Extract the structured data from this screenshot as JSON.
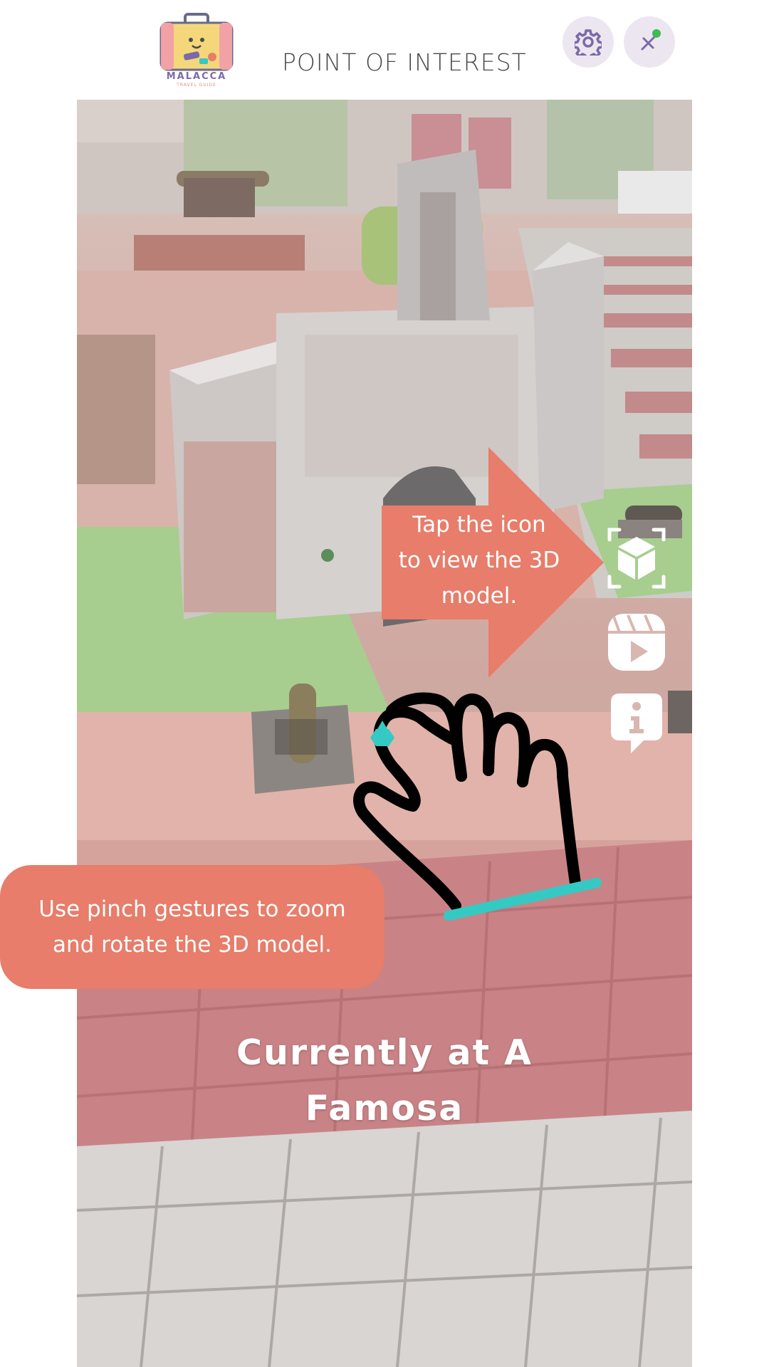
{
  "header": {
    "logo_text": "MALACCA",
    "logo_subtext": "TRAVEL GUIDE",
    "title": "POINT OF INTEREST",
    "settings_icon": "gear-icon",
    "ar_icon": "ar-toggle-icon"
  },
  "side_actions": [
    {
      "icon": "3d-cube-icon",
      "label": "View 3D model"
    },
    {
      "icon": "reels-play-icon",
      "label": "Play video"
    },
    {
      "icon": "info-icon",
      "label": "Info"
    }
  ],
  "hints": {
    "tap_icon": "Tap the icon to view the 3D model.",
    "tap_icon_lines": [
      "Tap the icon",
      "to view the 3D",
      "model."
    ],
    "pinch_lines": [
      "Use pinch gestures to zoom",
      "and rotate the 3D model."
    ]
  },
  "location": {
    "lines": [
      "Currently at A",
      "Famosa"
    ]
  },
  "colors": {
    "accent": "#e77d6a",
    "hand_accent": "#35c9c3",
    "button_bg": "#ece6f0",
    "icon_purple": "#7b6aa8",
    "status_dot": "#3dbb55"
  }
}
